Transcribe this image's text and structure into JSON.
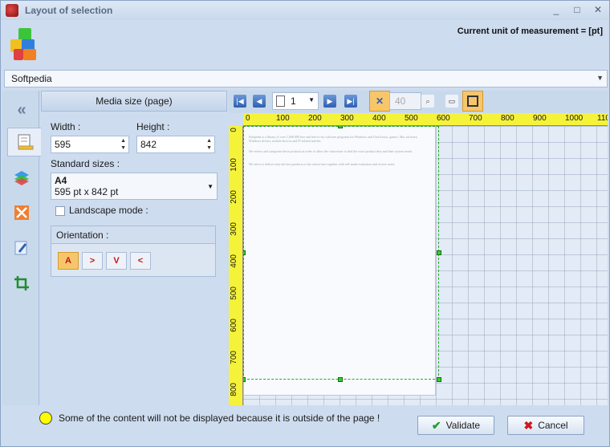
{
  "window": {
    "title": "Layout of selection",
    "minimize_label": "_",
    "restore_label": "□",
    "close_label": "✕"
  },
  "header": {
    "unit_label": "Current unit of measurement = [pt]"
  },
  "document_combo": {
    "value": "Softpedia"
  },
  "panel": {
    "title": "Media size (page)",
    "width_label": "Width :",
    "width_value": "595",
    "height_label": "Height :",
    "height_value": "842",
    "standard_sizes_label": "Standard sizes :",
    "standard_size_name": "A4",
    "standard_size_dims": "595 pt x 842 pt",
    "landscape_label": "Landscape mode :",
    "orientation_label": "Orientation :"
  },
  "preview": {
    "page_number": "1",
    "zoom_value": "40",
    "ruler_h_ticks": [
      "0",
      "100",
      "200",
      "300",
      "400",
      "500",
      "600",
      "700",
      "800",
      "900",
      "1000",
      "110"
    ],
    "ruler_v_ticks": [
      "0",
      "100",
      "200",
      "300",
      "400",
      "500",
      "600",
      "700",
      "800"
    ],
    "page_text": [
      "Softpedia is a library of over 1,000,000 free and free-to-try software programs for Windows and Unix/Linux, games, Mac software, Windows drivers, mobile devices and IT-related articles.",
      "We review and categorize these products in order to allow the visitor/user to find the exact product they and their system needs.",
      "We strive to deliver only the best products to the visitor/user together with self-made evaluation and review notes."
    ]
  },
  "status": {
    "message": "Some of the content will not be displayed because it is outside of the page !"
  },
  "buttons": {
    "validate": "Validate",
    "cancel": "Cancel"
  },
  "colors": {
    "ruler": "#f5f23a",
    "selection": "#25a825",
    "active_tool": "#f7c66b",
    "warning_dot": "#ffff00"
  }
}
